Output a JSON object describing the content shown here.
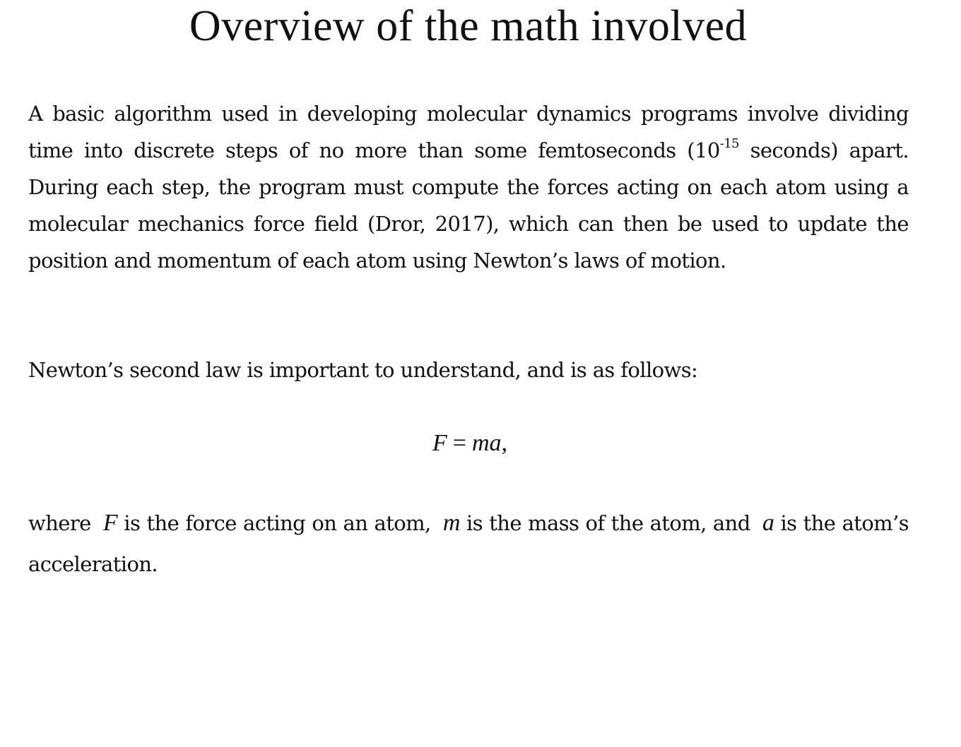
{
  "title": "Overview of the math involved",
  "paragraph1": {
    "text_before_exponent": "A basic algorithm used in developing molecular dynamics programs involve dividing time into discrete steps of no more than some femtoseconds (10",
    "exponent": "-15",
    "text_after_exponent": " seconds) apart. During each step, the program must compute the forces acting on each atom using a molecular mechanics force field (Dror, 2017), which can then be used to update the position and momentum of each atom using Newton’s laws of motion."
  },
  "paragraph2": {
    "text": "Newton’s second law is important to understand, and is as follows:"
  },
  "equation": {
    "lhs": "F",
    "operator": "=",
    "rhs": "ma",
    "trailing": ","
  },
  "paragraph3": {
    "part1": "where ",
    "var_force": "F",
    "part2": " is the force acting on an atom, ",
    "var_mass": "m",
    "part3": " is the mass of the atom, and ",
    "var_accel": "a",
    "part4": " is the atom’s acceleration."
  }
}
